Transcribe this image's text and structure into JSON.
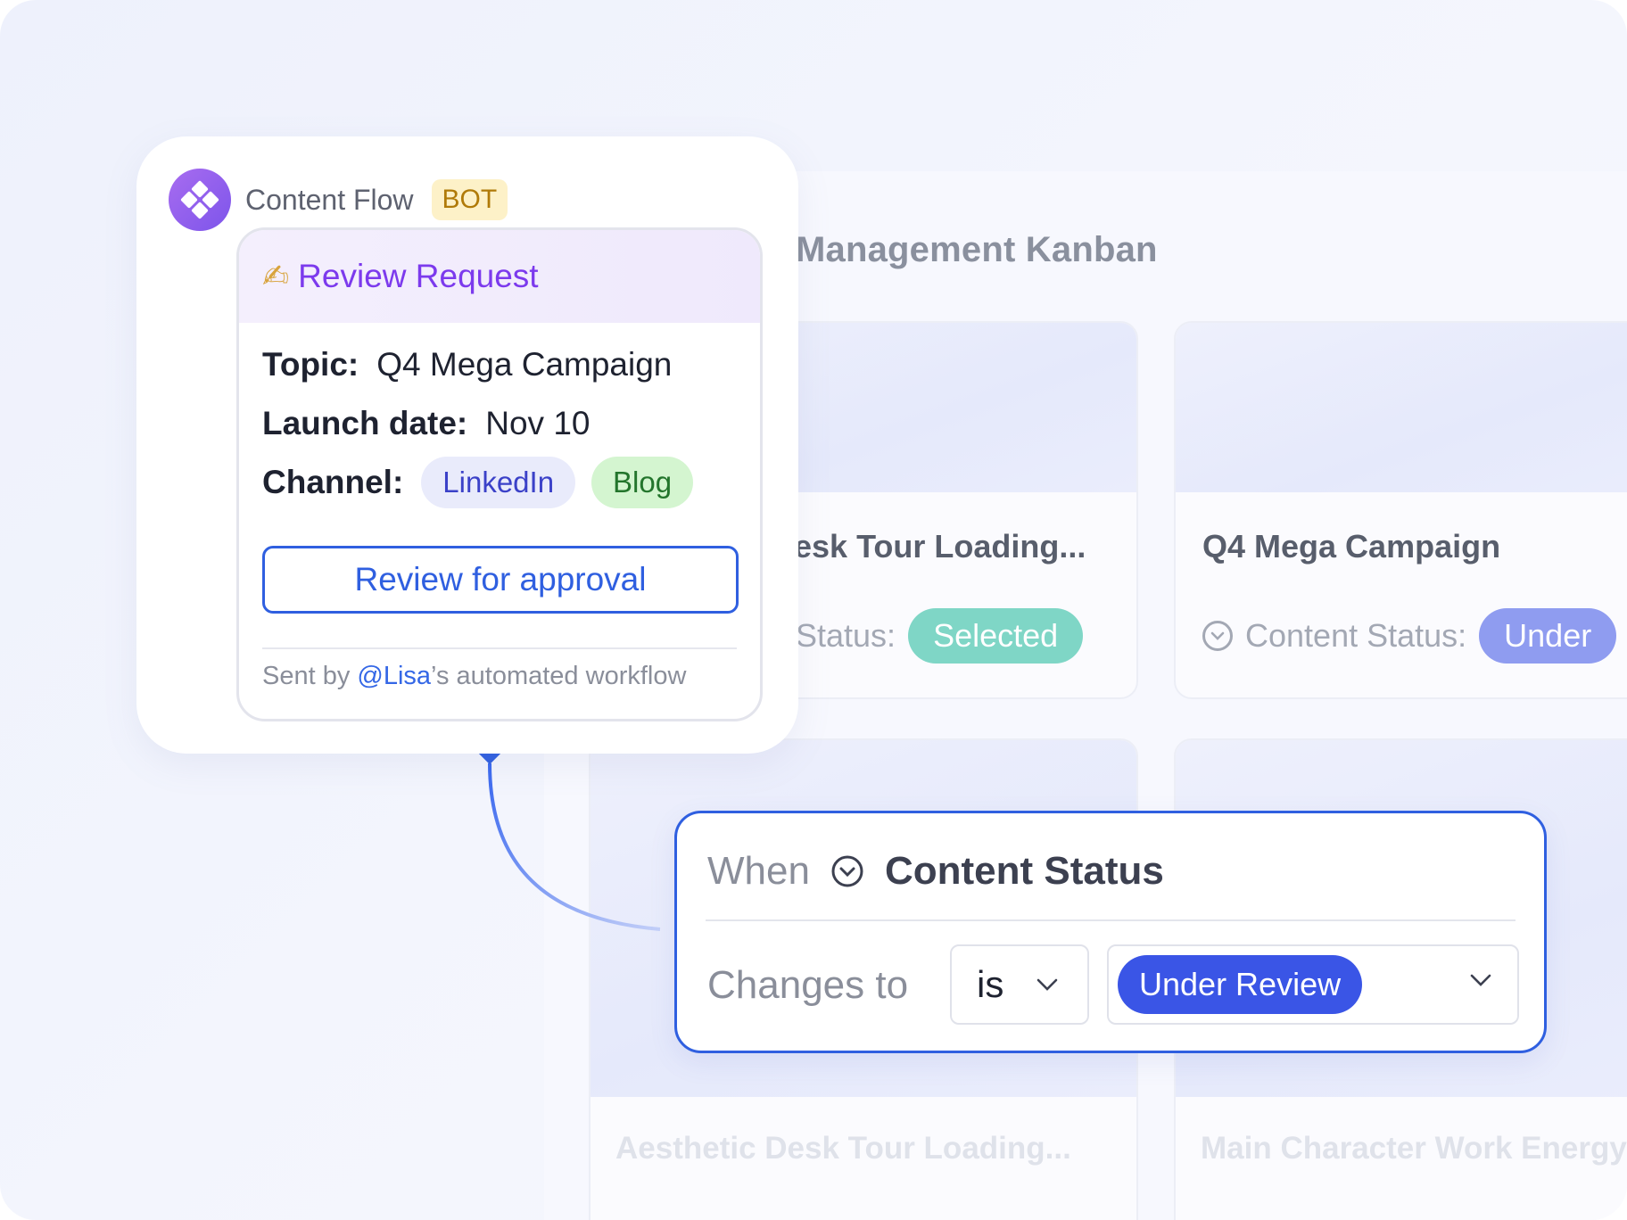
{
  "kanban": {
    "title": "Management Kanban",
    "cards": [
      {
        "title": "esk Tour Loading...",
        "status_label": "Status:",
        "status_value": "Selected",
        "status_color": "#7fd6c6"
      },
      {
        "title": "Q4 Mega Campaign",
        "status_label": "Content Status:",
        "status_value": "Under",
        "status_color": "#8f9cf0"
      }
    ],
    "faded_titles": [
      "Aesthetic Desk Tour Loading...",
      "Main Character Work Energy"
    ]
  },
  "bot": {
    "name": "Content Flow",
    "badge": "BOT",
    "message": {
      "emoji": "✍",
      "title": "Review Request",
      "topic_label": "Topic:",
      "topic_value": "Q4 Mega Campaign",
      "launch_label": "Launch date:",
      "launch_value": "Nov 10",
      "channel_label": "Channel:",
      "channels": [
        "LinkedIn",
        "Blog"
      ],
      "button_label": "Review for approval",
      "footer_prefix": "Sent by ",
      "footer_mention": "@Lisa",
      "footer_suffix": "’s automated workflow"
    }
  },
  "trigger": {
    "when_label": "When",
    "field_name": "Content Status",
    "changes_label": "Changes to",
    "operator": "is",
    "value": "Under Review"
  },
  "colors": {
    "accent_blue": "#2f5fe0",
    "bot_purple": "#7c3aed",
    "selected_teal": "#7fd6c6",
    "under_review_blue": "#3a55e6"
  }
}
